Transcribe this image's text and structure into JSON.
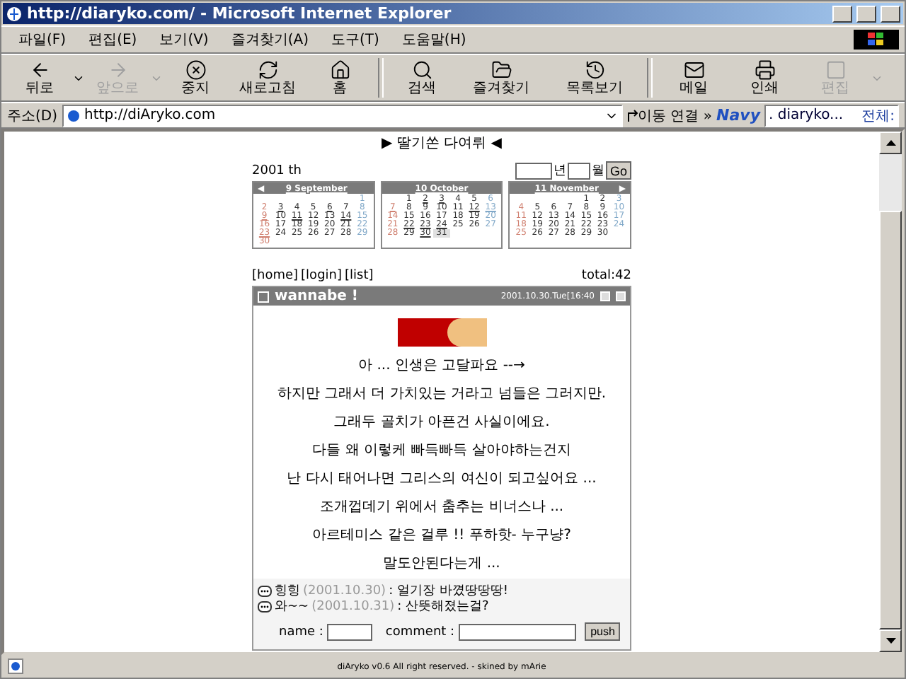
{
  "window": {
    "title": "http://diaryko.com/ - Microsoft Internet Explorer"
  },
  "menu": [
    "파일(F)",
    "편집(E)",
    "보기(V)",
    "즐겨찾기(A)",
    "도구(T)",
    "도움말(H)"
  ],
  "toolbar": [
    {
      "kind": "back",
      "label": "뒤로",
      "disabled": false,
      "dropdown": true
    },
    {
      "kind": "forward",
      "label": "앞으로",
      "disabled": true,
      "dropdown": true
    },
    {
      "kind": "stop",
      "label": "중지",
      "disabled": false,
      "dropdown": false
    },
    {
      "kind": "refresh",
      "label": "새로고침",
      "disabled": false,
      "dropdown": false
    },
    {
      "kind": "home",
      "label": "홈",
      "disabled": false,
      "dropdown": false
    },
    {
      "kind": "search",
      "label": "검색",
      "disabled": false,
      "dropdown": false
    },
    {
      "kind": "favorites",
      "label": "즐겨찾기",
      "disabled": false,
      "dropdown": false
    },
    {
      "kind": "history",
      "label": "목록보기",
      "disabled": false,
      "dropdown": false
    },
    {
      "kind": "mail",
      "label": "메일",
      "disabled": false,
      "dropdown": false
    },
    {
      "kind": "print",
      "label": "인쇄",
      "disabled": false,
      "dropdown": false
    },
    {
      "kind": "edit",
      "label": "편집",
      "disabled": true,
      "dropdown": true
    }
  ],
  "address": {
    "label": "주소(D)",
    "value": "http://diAryko.com",
    "go": "이동",
    "links": "연결",
    "more": "»"
  },
  "search_bar": {
    "logo": "Navy",
    "value": ". diaryko...",
    "scope": "전체:"
  },
  "page": {
    "heading": "▶ 딸기쏜 다여뤼 ◀",
    "year": "2001 th",
    "year_unit": "년",
    "month_unit": "월",
    "go": "Go",
    "calendars": [
      {
        "title": "9 September",
        "prev": "◀",
        "weeks": [
          [
            {
              "d": "1",
              "linked": false,
              "today": false
            }
          ],
          [
            {
              "d": "2",
              "linked": false,
              "today": false
            },
            {
              "d": "3",
              "linked": true,
              "today": false
            },
            {
              "d": "4",
              "linked": false,
              "today": false
            },
            {
              "d": "5",
              "linked": false,
              "today": false
            },
            {
              "d": "6",
              "linked": true,
              "today": false
            },
            {
              "d": "7",
              "linked": false,
              "today": false
            },
            {
              "d": "8",
              "linked": false,
              "today": false
            }
          ],
          [
            {
              "d": "9",
              "linked": true,
              "today": false
            },
            {
              "d": "10",
              "linked": false,
              "today": false
            },
            {
              "d": "11",
              "linked": true,
              "today": false
            },
            {
              "d": "12",
              "linked": false,
              "today": false
            },
            {
              "d": "13",
              "linked": false,
              "today": false
            },
            {
              "d": "14",
              "linked": true,
              "today": false
            },
            {
              "d": "15",
              "linked": false,
              "today": false
            }
          ],
          [
            {
              "d": "16",
              "linked": false,
              "today": false
            },
            {
              "d": "17",
              "linked": false,
              "today": false
            },
            {
              "d": "18",
              "linked": false,
              "today": false
            },
            {
              "d": "19",
              "linked": false,
              "today": false
            },
            {
              "d": "20",
              "linked": false,
              "today": false
            },
            {
              "d": "21",
              "linked": false,
              "today": false
            },
            {
              "d": "22",
              "linked": false,
              "today": false
            }
          ],
          [
            {
              "d": "23",
              "linked": true,
              "today": false
            },
            {
              "d": "24",
              "linked": false,
              "today": false
            },
            {
              "d": "25",
              "linked": false,
              "today": false
            },
            {
              "d": "26",
              "linked": false,
              "today": false
            },
            {
              "d": "27",
              "linked": false,
              "today": false
            },
            {
              "d": "28",
              "linked": false,
              "today": false
            },
            {
              "d": "29",
              "linked": false,
              "today": false
            }
          ],
          [
            {
              "d": "30",
              "linked": false,
              "today": false
            }
          ]
        ]
      },
      {
        "title": "10 October",
        "weeks": [
          [
            {
              "d": "1",
              "linked": false,
              "today": false
            },
            {
              "d": "2",
              "linked": true,
              "today": false
            },
            {
              "d": "3",
              "linked": true,
              "today": false
            },
            {
              "d": "4",
              "linked": false,
              "today": false
            },
            {
              "d": "5",
              "linked": false,
              "today": false
            },
            {
              "d": "6",
              "linked": false,
              "today": false
            }
          ],
          [
            {
              "d": "7",
              "linked": true,
              "today": false
            },
            {
              "d": "8",
              "linked": false,
              "today": false
            },
            {
              "d": "9",
              "linked": false,
              "today": false
            },
            {
              "d": "10",
              "linked": false,
              "today": false
            },
            {
              "d": "11",
              "linked": false,
              "today": false
            },
            {
              "d": "12",
              "linked": true,
              "today": false
            },
            {
              "d": "13",
              "linked": true,
              "today": false
            }
          ],
          [
            {
              "d": "14",
              "linked": false,
              "today": false
            },
            {
              "d": "15",
              "linked": false,
              "today": false
            },
            {
              "d": "16",
              "linked": false,
              "today": false
            },
            {
              "d": "17",
              "linked": false,
              "today": false
            },
            {
              "d": "18",
              "linked": false,
              "today": false
            },
            {
              "d": "19",
              "linked": false,
              "today": false
            },
            {
              "d": "20",
              "linked": false,
              "today": false
            }
          ],
          [
            {
              "d": "21",
              "linked": false,
              "today": false
            },
            {
              "d": "22",
              "linked": true,
              "today": false
            },
            {
              "d": "23",
              "linked": true,
              "today": false
            },
            {
              "d": "24",
              "linked": true,
              "today": false
            },
            {
              "d": "25",
              "linked": false,
              "today": false
            },
            {
              "d": "26",
              "linked": false,
              "today": false
            },
            {
              "d": "27",
              "linked": false,
              "today": false
            }
          ],
          [
            {
              "d": "28",
              "linked": false,
              "today": false
            },
            {
              "d": "29",
              "linked": false,
              "today": false
            },
            {
              "d": "30",
              "linked": true,
              "today": false
            },
            {
              "d": "31",
              "linked": false,
              "today": true
            }
          ]
        ]
      },
      {
        "title": "11 November",
        "next": "▶",
        "weeks": [
          [
            {
              "d": "1",
              "linked": false,
              "today": false
            },
            {
              "d": "2",
              "linked": false,
              "today": false
            },
            {
              "d": "3",
              "linked": false,
              "today": false
            }
          ],
          [
            {
              "d": "4",
              "linked": false,
              "today": false
            },
            {
              "d": "5",
              "linked": false,
              "today": false
            },
            {
              "d": "6",
              "linked": false,
              "today": false
            },
            {
              "d": "7",
              "linked": false,
              "today": false
            },
            {
              "d": "8",
              "linked": false,
              "today": false
            },
            {
              "d": "9",
              "linked": false,
              "today": false
            },
            {
              "d": "10",
              "linked": false,
              "today": false
            }
          ],
          [
            {
              "d": "11",
              "linked": false,
              "today": false
            },
            {
              "d": "12",
              "linked": false,
              "today": false
            },
            {
              "d": "13",
              "linked": false,
              "today": false
            },
            {
              "d": "14",
              "linked": false,
              "today": false
            },
            {
              "d": "15",
              "linked": false,
              "today": false
            },
            {
              "d": "16",
              "linked": false,
              "today": false
            },
            {
              "d": "17",
              "linked": false,
              "today": false
            }
          ],
          [
            {
              "d": "18",
              "linked": false,
              "today": false
            },
            {
              "d": "19",
              "linked": false,
              "today": false
            },
            {
              "d": "20",
              "linked": false,
              "today": false
            },
            {
              "d": "21",
              "linked": false,
              "today": false
            },
            {
              "d": "22",
              "linked": false,
              "today": false
            },
            {
              "d": "23",
              "linked": false,
              "today": false
            },
            {
              "d": "24",
              "linked": false,
              "today": false
            }
          ],
          [
            {
              "d": "25",
              "linked": false,
              "today": false
            },
            {
              "d": "26",
              "linked": false,
              "today": false
            },
            {
              "d": "27",
              "linked": false,
              "today": false
            },
            {
              "d": "28",
              "linked": false,
              "today": false
            },
            {
              "d": "29",
              "linked": false,
              "today": false
            },
            {
              "d": "30",
              "linked": false,
              "today": false
            }
          ]
        ]
      }
    ],
    "nav_links": [
      "[home]",
      "[login]",
      "[list]"
    ],
    "total": "total:42",
    "post": {
      "title": "wannabe !",
      "date": "2001.10.30.Tue[16:40",
      "lines": [
        "아 ... 인생은 고달파요 --→",
        "하지만 그래서 더 가치있는 거라고 넘들은 그러지만.",
        "그래두 골치가 아픈건 사실이에요.",
        "다들 왜 이렇케 빠득빠득 살아야하는건지",
        "난 다시 태어나면 그리스의 여신이 되고싶어요 ...",
        "조개껍데기 위에서 춤추는 비너스나 ...",
        "아르테미스 같은 걸루 !! 푸하핫- 누구냥?",
        "말도안된다는게 ..."
      ],
      "comments": [
        {
          "author": "힝힝",
          "date": "(2001.10.30)",
          "text": ": 얼기장 바꼈땅땅땅!"
        },
        {
          "author": "와~~",
          "date": "(2001.10.31)",
          "text": ": 산뜻해졌는걸?"
        }
      ],
      "form": {
        "name_label": "name :",
        "comment_label": "comment :",
        "button": "push"
      }
    },
    "footer": "diAryko v0.6 All right reserved. - skined by mArie"
  }
}
